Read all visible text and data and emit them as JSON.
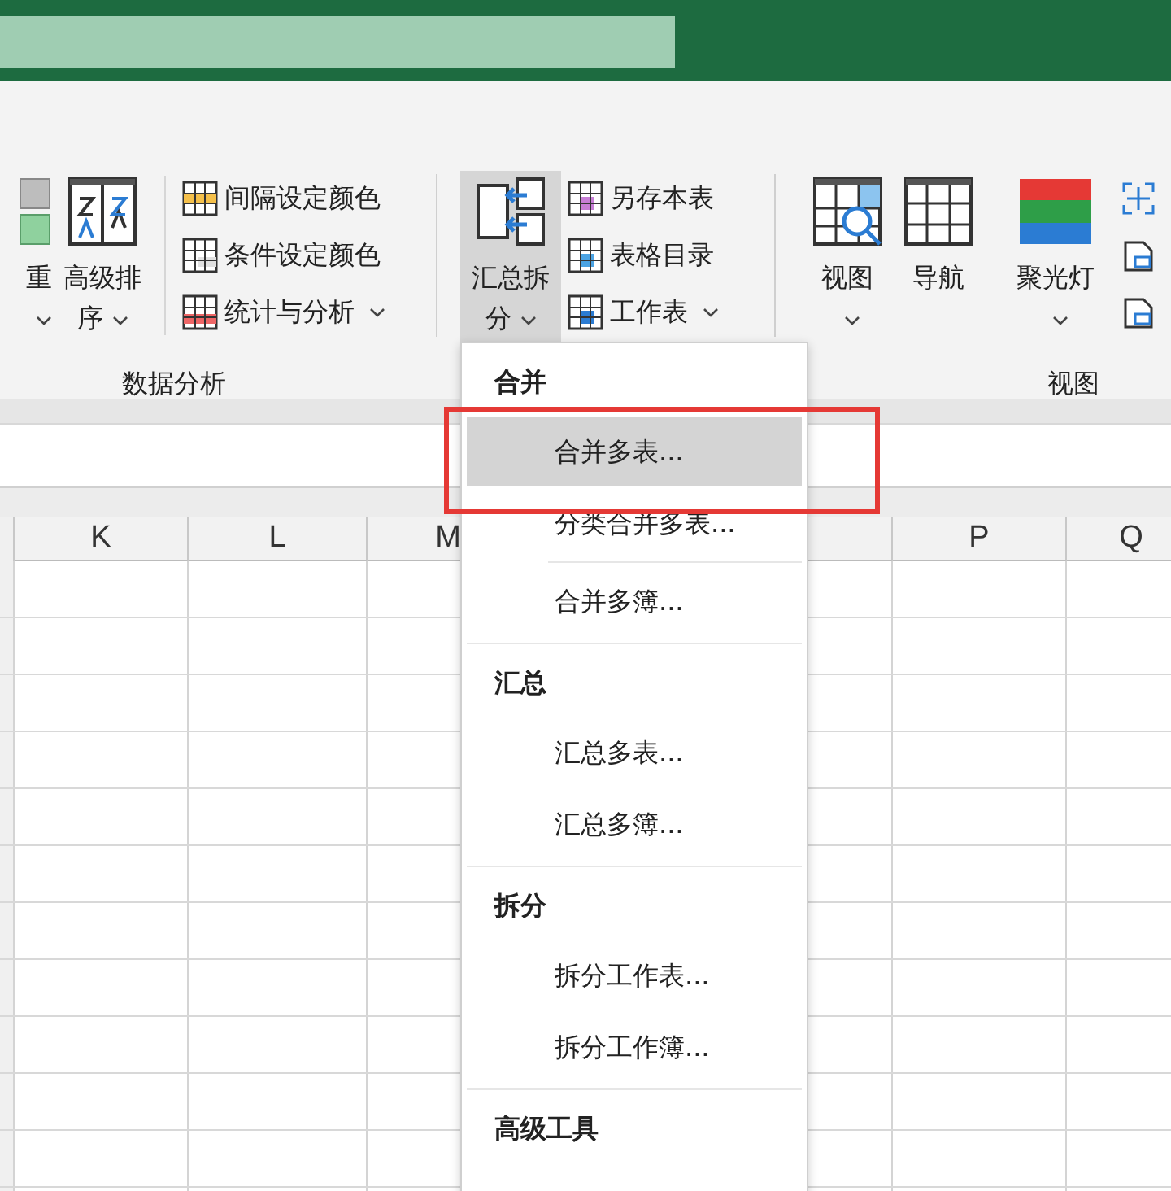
{
  "ribbon": {
    "groups": [
      {
        "label": "数据分析",
        "columns": [
          {
            "kind": "large",
            "label": "重",
            "dropdown": true,
            "pressed": false
          },
          {
            "kind": "large",
            "label": "高级排序",
            "dropdown": true,
            "pressed": false
          },
          {
            "kind": "separator"
          },
          {
            "kind": "stack",
            "items": [
              {
                "label": "间隔设定颜色",
                "dropdown": false
              },
              {
                "label": "条件设定颜色",
                "dropdown": false
              },
              {
                "label": "统计与分析",
                "dropdown": true
              }
            ]
          }
        ]
      },
      {
        "columns": [
          {
            "kind": "large",
            "label": "汇总拆分",
            "dropdown": true,
            "pressed": true
          },
          {
            "kind": "stack",
            "items": [
              {
                "label": "另存本表",
                "dropdown": false
              },
              {
                "label": "表格目录",
                "dropdown": false
              },
              {
                "label": "工作表",
                "dropdown": true
              }
            ]
          }
        ]
      },
      {
        "label": "视图",
        "columns": [
          {
            "kind": "large",
            "label": "视图",
            "dropdown": true,
            "pressed": false
          },
          {
            "kind": "large",
            "label": "导航",
            "dropdown": false,
            "pressed": false
          },
          {
            "kind": "large",
            "label": "聚光灯",
            "dropdown": true,
            "pressed": false
          }
        ]
      }
    ]
  },
  "sheet": {
    "columns": [
      {
        "label": "K"
      },
      {
        "label": "L"
      },
      {
        "label": "M"
      },
      {
        "label": "P"
      },
      {
        "label": "Q"
      }
    ]
  },
  "menu": {
    "sections": [
      {
        "title": "合并",
        "items": [
          {
            "label": "合并多表...",
            "selected": true,
            "separated": false
          },
          {
            "label": "分类合并多表...",
            "selected": false,
            "separated": false
          },
          {
            "label": "合并多簿...",
            "selected": false,
            "separated": true
          }
        ]
      },
      {
        "title": "汇总",
        "items": [
          {
            "label": "汇总多表...",
            "selected": false,
            "separated": false
          },
          {
            "label": "汇总多簿...",
            "selected": false,
            "separated": false
          }
        ]
      },
      {
        "title": "拆分",
        "items": [
          {
            "label": "拆分工作表...",
            "selected": false,
            "separated": false
          },
          {
            "label": "拆分工作簿...",
            "selected": false,
            "separated": false
          }
        ]
      },
      {
        "title": "高级工具"
      }
    ]
  }
}
